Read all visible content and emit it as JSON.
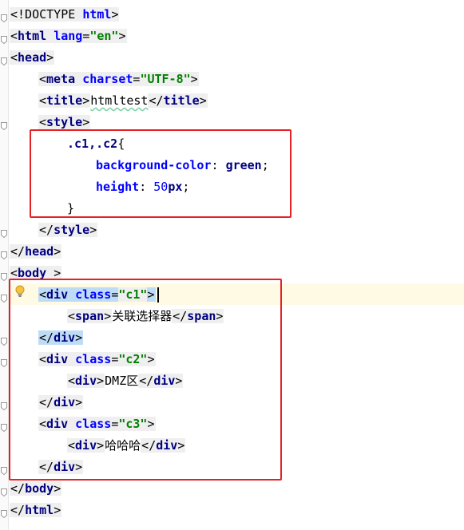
{
  "editor": {
    "lines": [
      {
        "id": "doctype",
        "parts": [
          [
            "tag",
            "<!DOCTYPE "
          ],
          [
            "attr",
            "html"
          ],
          [
            "tag",
            ">"
          ]
        ]
      },
      {
        "id": "html-open",
        "parts": [
          [
            "tag",
            "<"
          ],
          [
            "tagname",
            "html"
          ],
          [
            "txt",
            " "
          ],
          [
            "attr",
            "lang"
          ],
          [
            "punct",
            "="
          ],
          [
            "str",
            "\"en\""
          ],
          [
            "tag",
            ">"
          ]
        ]
      },
      {
        "id": "head-open",
        "parts": [
          [
            "tag",
            "<"
          ],
          [
            "tagname",
            "head"
          ],
          [
            "tag",
            ">"
          ]
        ]
      },
      {
        "id": "meta",
        "parts": [
          [
            "tag",
            "<"
          ],
          [
            "tagname",
            "meta"
          ],
          [
            "txt",
            " "
          ],
          [
            "attr",
            "charset"
          ],
          [
            "punct",
            "="
          ],
          [
            "str",
            "\"UTF-8\""
          ],
          [
            "tag",
            ">"
          ]
        ]
      },
      {
        "id": "title",
        "parts": [
          [
            "tag",
            "<"
          ],
          [
            "tagname",
            "title"
          ],
          [
            "tag",
            ">"
          ],
          [
            "squig",
            "htmltest"
          ],
          [
            "tag",
            "</"
          ],
          [
            "tagname",
            "title"
          ],
          [
            "tag",
            ">"
          ]
        ]
      },
      {
        "id": "style-open",
        "parts": [
          [
            "tag",
            "<"
          ],
          [
            "tagname",
            "style"
          ],
          [
            "tag",
            ">"
          ]
        ]
      },
      {
        "id": "css-selector",
        "parts": [
          [
            "sel",
            ".c1,.c2"
          ],
          [
            "punct",
            "{"
          ]
        ]
      },
      {
        "id": "css-bg",
        "parts": [
          [
            "prop",
            "background-color"
          ],
          [
            "punct",
            ": "
          ],
          [
            "cssval",
            "green"
          ],
          [
            "punct",
            ";"
          ]
        ]
      },
      {
        "id": "css-height",
        "parts": [
          [
            "prop",
            "height"
          ],
          [
            "punct",
            ": "
          ],
          [
            "num",
            "50"
          ],
          [
            "cssval",
            "px"
          ],
          [
            "punct",
            ";"
          ]
        ]
      },
      {
        "id": "css-close",
        "parts": [
          [
            "punct",
            "}"
          ]
        ]
      },
      {
        "id": "style-close",
        "parts": [
          [
            "tag",
            "</"
          ],
          [
            "tagname",
            "style"
          ],
          [
            "tag",
            ">"
          ]
        ]
      },
      {
        "id": "head-close",
        "parts": [
          [
            "tag",
            "</"
          ],
          [
            "tagname",
            "head"
          ],
          [
            "tag",
            ">"
          ]
        ]
      },
      {
        "id": "body-open",
        "parts": [
          [
            "tag",
            "<"
          ],
          [
            "tagname",
            "body"
          ],
          [
            "txt",
            " "
          ],
          [
            "tag",
            ">"
          ]
        ]
      },
      {
        "id": "div-c1-open",
        "parts": [
          [
            "tag",
            "<"
          ],
          [
            "tagname",
            "div"
          ],
          [
            "txt",
            " "
          ],
          [
            "attr",
            "class"
          ],
          [
            "punct",
            "="
          ],
          [
            "str",
            "\"c1\""
          ],
          [
            "tag",
            ">"
          ]
        ]
      },
      {
        "id": "span",
        "parts": [
          [
            "tag",
            "<"
          ],
          [
            "tagname",
            "span"
          ],
          [
            "tag",
            ">"
          ],
          [
            "txt",
            "关联选择器"
          ],
          [
            "tag",
            "</"
          ],
          [
            "tagname",
            "span"
          ],
          [
            "tag",
            ">"
          ]
        ]
      },
      {
        "id": "div-c1-close",
        "parts": [
          [
            "tag",
            "</"
          ],
          [
            "tagname",
            "div"
          ],
          [
            "tag",
            ">"
          ]
        ]
      },
      {
        "id": "div-c2-open",
        "parts": [
          [
            "tag",
            "<"
          ],
          [
            "tagname",
            "div"
          ],
          [
            "txt",
            " "
          ],
          [
            "attr",
            "class"
          ],
          [
            "punct",
            "="
          ],
          [
            "str",
            "\"c2\""
          ],
          [
            "tag",
            ">"
          ]
        ]
      },
      {
        "id": "div-dmz",
        "parts": [
          [
            "tag",
            "<"
          ],
          [
            "tagname",
            "div"
          ],
          [
            "tag",
            ">"
          ],
          [
            "txt",
            "DMZ区"
          ],
          [
            "tag",
            "</"
          ],
          [
            "tagname",
            "div"
          ],
          [
            "tag",
            ">"
          ]
        ]
      },
      {
        "id": "div-c2-close",
        "parts": [
          [
            "tag",
            "</"
          ],
          [
            "tagname",
            "div"
          ],
          [
            "tag",
            ">"
          ]
        ]
      },
      {
        "id": "div-c3-open",
        "parts": [
          [
            "tag",
            "<"
          ],
          [
            "tagname",
            "div"
          ],
          [
            "txt",
            " "
          ],
          [
            "attr",
            "class"
          ],
          [
            "punct",
            "="
          ],
          [
            "str",
            "\"c3\""
          ],
          [
            "tag",
            ">"
          ]
        ]
      },
      {
        "id": "div-haha",
        "parts": [
          [
            "tag",
            "<"
          ],
          [
            "tagname",
            "div"
          ],
          [
            "tag",
            ">"
          ],
          [
            "txt",
            "哈哈哈"
          ],
          [
            "tag",
            "</"
          ],
          [
            "tagname",
            "div"
          ],
          [
            "tag",
            ">"
          ]
        ]
      },
      {
        "id": "div-c3-close",
        "parts": [
          [
            "tag",
            "</"
          ],
          [
            "tagname",
            "div"
          ],
          [
            "tag",
            ">"
          ]
        ]
      },
      {
        "id": "body-close",
        "parts": [
          [
            "tag",
            "</"
          ],
          [
            "tagname",
            "body"
          ],
          [
            "tag",
            ">"
          ]
        ]
      },
      {
        "id": "html-close",
        "parts": [
          [
            "tag",
            "</"
          ],
          [
            "tagname",
            "html"
          ],
          [
            "tag",
            ">"
          ]
        ]
      }
    ]
  },
  "icons": {
    "intention": "lightbulb-icon"
  },
  "colors": {
    "highlight_box": "#e62124",
    "caret_line": "#fffae3",
    "tag_match": "#bfdcf6"
  }
}
